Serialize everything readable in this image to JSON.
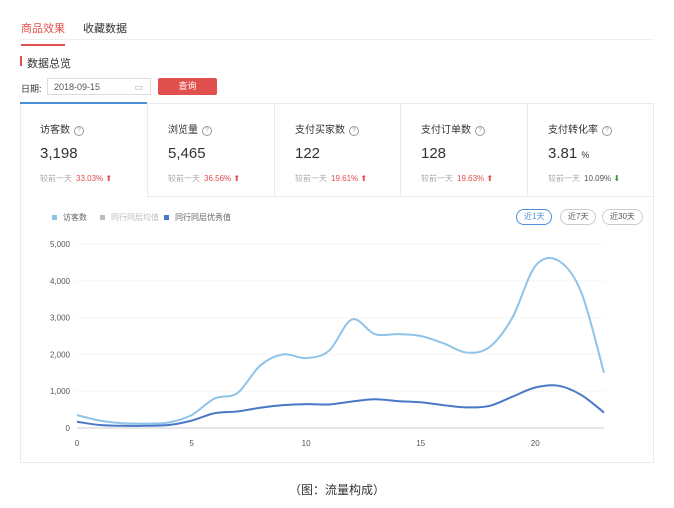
{
  "tabs": [
    "商品效果",
    "收藏数据"
  ],
  "section_title": "数据总览",
  "date": {
    "label": "日期:",
    "value": "2018-09-15",
    "query_label": "查询"
  },
  "cards": [
    {
      "title": "访客数",
      "value": "3,198",
      "compare_label": "较前一天",
      "change": "33.03%",
      "dir": "up"
    },
    {
      "title": "浏览量",
      "value": "5,465",
      "compare_label": "较前一天",
      "change": "36.56%",
      "dir": "up"
    },
    {
      "title": "支付买家数",
      "value": "122",
      "compare_label": "较前一天",
      "change": "19.61%",
      "dir": "up"
    },
    {
      "title": "支付订单数",
      "value": "128",
      "compare_label": "较前一天",
      "change": "19.63%",
      "dir": "up"
    },
    {
      "title": "支付转化率",
      "value": "3.81",
      "unit": "%",
      "compare_label": "较前一天",
      "change": "10.09%",
      "dir": "down"
    }
  ],
  "ranges": [
    "近1天",
    "近7天",
    "近30天"
  ],
  "caption": "（图：流量构成）",
  "colors": {
    "accent": "#e0504d",
    "visitors": "#8fc3e8",
    "avg": "#bbbbbb",
    "excellent": "#4a78c8"
  },
  "chart_data": {
    "type": "line",
    "legend": [
      "访客数",
      "同行同层均值",
      "同行同层优秀值"
    ],
    "x": [
      0,
      1,
      2,
      3,
      4,
      5,
      6,
      7,
      8,
      9,
      10,
      11,
      12,
      13,
      14,
      15,
      16,
      17,
      18,
      19,
      20,
      21,
      22,
      23
    ],
    "xticks": [
      0,
      5,
      10,
      15,
      20
    ],
    "yticks": [
      0,
      1000,
      2000,
      3000,
      4000,
      5000
    ],
    "ytick_labels": [
      "0",
      "1,000",
      "2,000",
      "3,000",
      "4,000",
      "5,000"
    ],
    "ylim": [
      0,
      5000
    ],
    "series": [
      {
        "name": "访客数",
        "values": [
          350,
          200,
          130,
          120,
          150,
          350,
          800,
          950,
          1700,
          2000,
          1900,
          2100,
          2950,
          2550,
          2550,
          2500,
          2300,
          2050,
          2200,
          3000,
          4400,
          4550,
          3700,
          1500
        ]
      },
      {
        "name": "同行同层优秀值",
        "values": [
          170,
          80,
          60,
          60,
          80,
          200,
          400,
          450,
          550,
          620,
          650,
          640,
          720,
          780,
          730,
          700,
          620,
          560,
          600,
          850,
          1100,
          1150,
          900,
          420
        ]
      }
    ]
  }
}
